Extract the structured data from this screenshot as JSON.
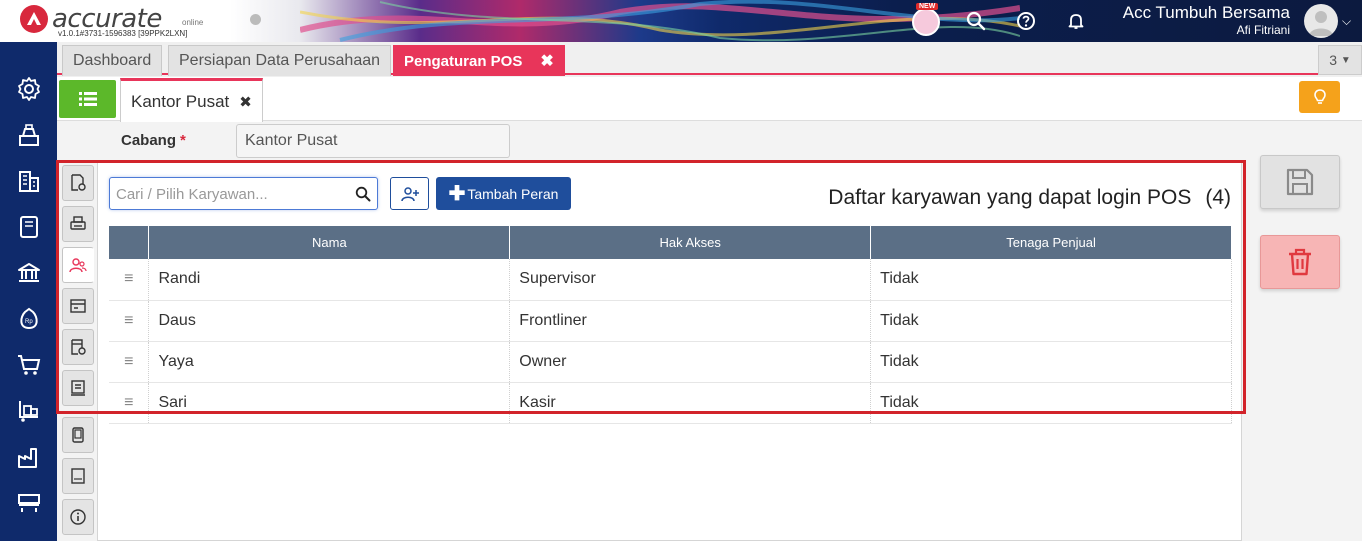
{
  "app": {
    "logo_text": "accurate",
    "logo_sub": "online",
    "version": "v1.0.1#3731-1596383 [39PPK2LXN]",
    "new_badge": "NEW",
    "company": "Acc Tumbuh Bersama",
    "user": "Afi Fitriani"
  },
  "tabs": [
    {
      "label": "Dashboard"
    },
    {
      "label": "Persiapan Data Perusahaan"
    },
    {
      "label": "Pengaturan POS"
    }
  ],
  "tab_count": "3",
  "subtab": {
    "label": "Kantor Pusat"
  },
  "form": {
    "cabang_label": "Cabang",
    "required_mark": "*",
    "cabang_value": "Kantor Pusat"
  },
  "employees": {
    "search_placeholder": "Cari / Pilih Karyawan...",
    "add_role_label": "Tambah Peran",
    "title": "Daftar karyawan yang dapat login POS",
    "count": "(4)",
    "columns": [
      "Nama",
      "Hak Akses",
      "Tenaga Penjual"
    ],
    "rows": [
      {
        "nama": "Randi",
        "hak_akses": "Supervisor",
        "tenaga_penjual": "Tidak"
      },
      {
        "nama": "Daus",
        "hak_akses": "Frontliner",
        "tenaga_penjual": "Tidak"
      },
      {
        "nama": "Yaya",
        "hak_akses": "Owner",
        "tenaga_penjual": "Tidak"
      },
      {
        "nama": "Sari",
        "hak_akses": "Kasir",
        "tenaga_penjual": "Tidak"
      }
    ]
  },
  "colors": {
    "accent": "#e8355a",
    "sidebar": "#0f2a6b",
    "primary_button": "#1f4e9c",
    "table_header": "#5b6f86",
    "highlight": "#d2232a"
  }
}
